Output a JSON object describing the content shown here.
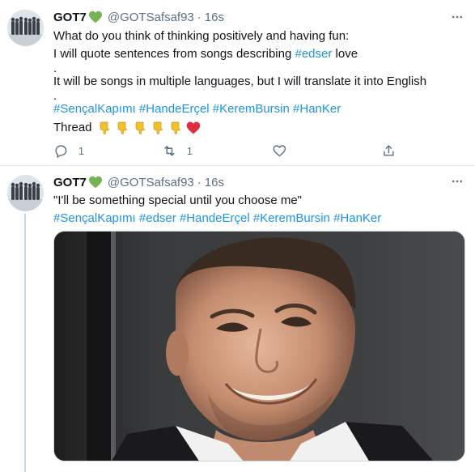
{
  "tweets": [
    {
      "author": {
        "name": "GOT7",
        "handle": "@GOTSafsaf93",
        "time": "16s",
        "separator": "·"
      },
      "lines": [
        {
          "kind": "text",
          "text": "What do you think of thinking positively and having fun:"
        },
        {
          "kind": "text-tag",
          "before": "I will quote sentences from songs describing ",
          "tag": "#edser",
          "after": " love"
        },
        {
          "kind": "dot",
          "text": "."
        },
        {
          "kind": "text",
          "text": "It will be songs in multiple languages, but I will translate it into English"
        },
        {
          "kind": "dot",
          "text": "."
        },
        {
          "kind": "tags",
          "tags": [
            "#SençalKapımı",
            "#HandeErçel",
            "#KeremBursin",
            "#HanKer"
          ]
        },
        {
          "kind": "thread",
          "text": "Thread"
        }
      ],
      "thread_emojis": [
        "pointing-down-hand-icon",
        "pointing-down-hand-icon",
        "pointing-down-hand-icon",
        "pointing-down-hand-icon",
        "pointing-down-hand-icon",
        "red-heart-icon"
      ],
      "actions": {
        "reply_count": "1",
        "retweet_count": "1",
        "like_count": "",
        "share_label": ""
      }
    },
    {
      "author": {
        "name": "GOT7",
        "handle": "@GOTSafsaf93",
        "time": "16s",
        "separator": "·"
      },
      "quote": "\"I'll be something special until you choose me\"",
      "tags": [
        "#SençalKapımı",
        "#edser",
        "#HandeErçel",
        "#KeremBursin",
        "#HanKer"
      ],
      "media": {
        "icon": "photo-of-smiling-man"
      }
    }
  ],
  "colors": {
    "link": "#1b95e0",
    "secondary": "#5b7083",
    "name_heart": "#77b255",
    "divider": "#e6ecf0"
  }
}
